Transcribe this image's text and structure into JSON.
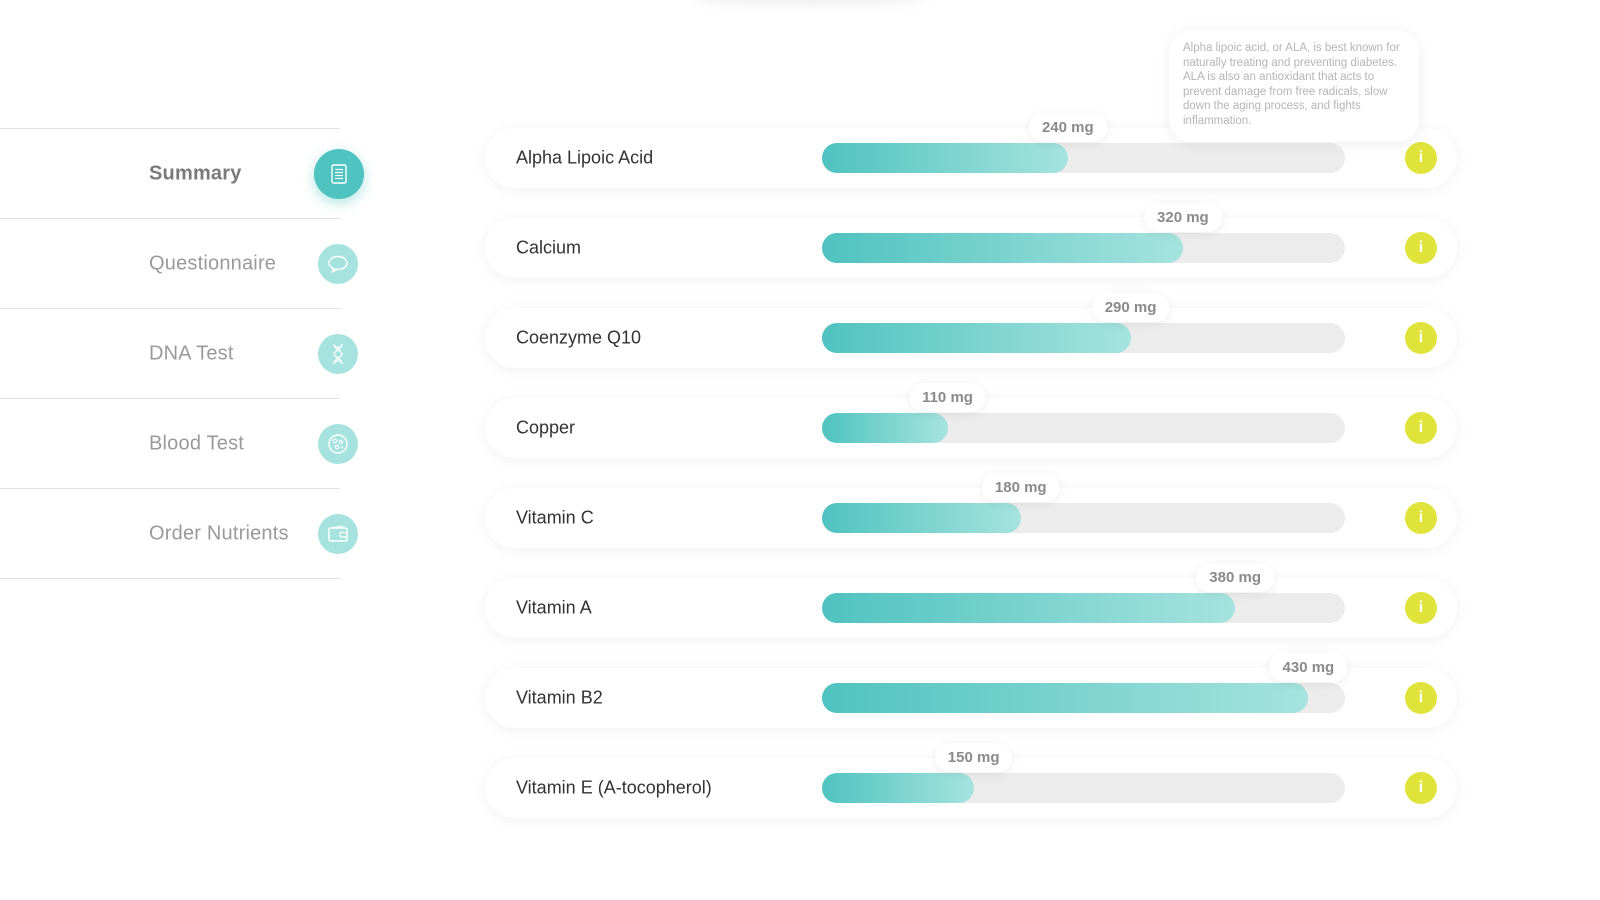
{
  "sidebar": {
    "items": [
      {
        "label": "Summary",
        "icon": "document-icon",
        "active": true
      },
      {
        "label": "Questionnaire",
        "icon": "speech-bubble-icon",
        "active": false
      },
      {
        "label": "DNA Test",
        "icon": "dna-icon",
        "active": false
      },
      {
        "label": "Blood Test",
        "icon": "blood-cell-icon",
        "active": false
      },
      {
        "label": "Order Nutrients",
        "icon": "wallet-icon",
        "active": false
      }
    ]
  },
  "tooltip": {
    "text": "Alpha lipoic acid, or ALA, is best known for naturally treating and preventing diabetes. ALA is also an antioxidant that acts to prevent damage from free radicals, slow down the aging process, and fights inflammation."
  },
  "nutrients": [
    {
      "name": "Alpha Lipoic Acid",
      "amount_label": "240 mg",
      "fill_fraction": 0.47
    },
    {
      "name": "Calcium",
      "amount_label": "320 mg",
      "fill_fraction": 0.69
    },
    {
      "name": "Coenzyme Q10",
      "amount_label": "290 mg",
      "fill_fraction": 0.59
    },
    {
      "name": "Copper",
      "amount_label": "110 mg",
      "fill_fraction": 0.24
    },
    {
      "name": "Vitamin C",
      "amount_label": "180 mg",
      "fill_fraction": 0.38
    },
    {
      "name": "Vitamin A",
      "amount_label": "380 mg",
      "fill_fraction": 0.79
    },
    {
      "name": "Vitamin B2",
      "amount_label": "430 mg",
      "fill_fraction": 0.93
    },
    {
      "name": "Vitamin E (A-tocopherol)",
      "amount_label": "150 mg",
      "fill_fraction": 0.29
    }
  ],
  "info_button_label": "i",
  "colors": {
    "accent": "#4fc3bf",
    "accent_light": "#a6e3df",
    "info": "#e0e43a",
    "track": "#ececec"
  }
}
